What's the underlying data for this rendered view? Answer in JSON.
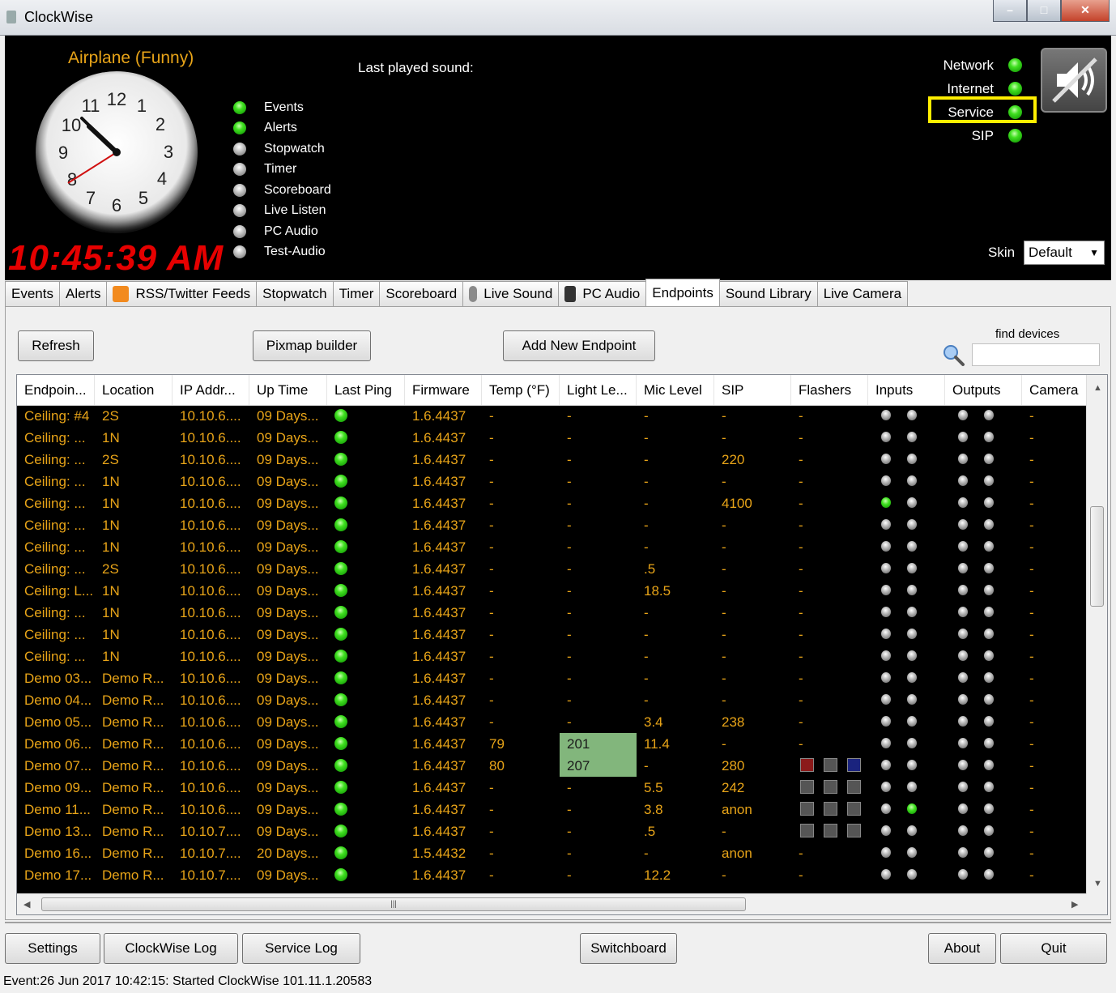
{
  "window": {
    "title": "ClockWise"
  },
  "header": {
    "track_name": "Airplane (Funny)",
    "digital_time": "10:45:39 AM",
    "last_played_label": "Last played sound:",
    "status_items": [
      {
        "label": "Events",
        "state": "green"
      },
      {
        "label": "Alerts",
        "state": "green"
      },
      {
        "label": "Stopwatch",
        "state": "grey"
      },
      {
        "label": "Timer",
        "state": "grey"
      },
      {
        "label": "Scoreboard",
        "state": "grey"
      },
      {
        "label": "Live Listen",
        "state": "grey"
      },
      {
        "label": "PC Audio",
        "state": "grey"
      },
      {
        "label": "Test-Audio",
        "state": "grey"
      }
    ],
    "network_status": [
      {
        "label": "Network",
        "state": "green"
      },
      {
        "label": "Internet",
        "state": "green"
      },
      {
        "label": "Service",
        "state": "green",
        "highlighted": true
      },
      {
        "label": "SIP",
        "state": "green"
      }
    ],
    "skin_label": "Skin",
    "skin_value": "Default"
  },
  "tabs": [
    {
      "label": "Events"
    },
    {
      "label": "Alerts"
    },
    {
      "label": "RSS/Twitter Feeds",
      "icon": "rss-icon"
    },
    {
      "label": "Stopwatch"
    },
    {
      "label": "Timer"
    },
    {
      "label": "Scoreboard"
    },
    {
      "label": "Live Sound",
      "icon": "microphone-icon"
    },
    {
      "label": "PC Audio",
      "icon": "speaker-icon"
    },
    {
      "label": "Endpoints",
      "active": true
    },
    {
      "label": "Sound Library"
    },
    {
      "label": "Live Camera"
    }
  ],
  "toolbar": {
    "refresh": "Refresh",
    "pixmap": "Pixmap builder",
    "add_endpoint": "Add New Endpoint",
    "find_label": "find devices",
    "find_value": ""
  },
  "grid": {
    "columns": [
      "Endpoin...",
      "Location",
      "IP Addr...",
      "Up Time",
      "Last Ping",
      "Firmware",
      "Temp (°F)",
      "Light Le...",
      "Mic Level",
      "SIP",
      "Flashers",
      "Inputs",
      "Outputs",
      "Camera"
    ],
    "rows": [
      {
        "endpoint": "Ceiling: #4",
        "location": "2S",
        "ip": "10.10.6....",
        "uptime": "09 Days...",
        "firmware": "1.6.4437",
        "temp": "-",
        "light": "-",
        "mic": "-",
        "sip": "-",
        "flashers": "-",
        "inputs": [
          "grey",
          "grey"
        ],
        "outputs": [
          "grey",
          "grey"
        ],
        "camera": "-"
      },
      {
        "endpoint": "Ceiling: ...",
        "location": "1N",
        "ip": "10.10.6....",
        "uptime": "09 Days...",
        "firmware": "1.6.4437",
        "temp": "-",
        "light": "-",
        "mic": "-",
        "sip": "-",
        "flashers": "-",
        "inputs": [
          "grey",
          "grey"
        ],
        "outputs": [
          "grey",
          "grey"
        ],
        "camera": "-"
      },
      {
        "endpoint": "Ceiling: ...",
        "location": "2S",
        "ip": "10.10.6....",
        "uptime": "09 Days...",
        "firmware": "1.6.4437",
        "temp": "-",
        "light": "-",
        "mic": "-",
        "sip": "220",
        "flashers": "-",
        "inputs": [
          "grey",
          "grey"
        ],
        "outputs": [
          "grey",
          "grey"
        ],
        "camera": "-"
      },
      {
        "endpoint": "Ceiling: ...",
        "location": "1N",
        "ip": "10.10.6....",
        "uptime": "09 Days...",
        "firmware": "1.6.4437",
        "temp": "-",
        "light": "-",
        "mic": "-",
        "sip": "-",
        "flashers": "-",
        "inputs": [
          "grey",
          "grey"
        ],
        "outputs": [
          "grey",
          "grey"
        ],
        "camera": "-"
      },
      {
        "endpoint": "Ceiling: ...",
        "location": "1N",
        "ip": "10.10.6....",
        "uptime": "09 Days...",
        "firmware": "1.6.4437",
        "temp": "-",
        "light": "-",
        "mic": "-",
        "sip": "4100",
        "flashers": "-",
        "inputs": [
          "green",
          "grey"
        ],
        "outputs": [
          "grey",
          "grey"
        ],
        "camera": "-"
      },
      {
        "endpoint": "Ceiling: ...",
        "location": "1N",
        "ip": "10.10.6....",
        "uptime": "09 Days...",
        "firmware": "1.6.4437",
        "temp": "-",
        "light": "-",
        "mic": "-",
        "sip": "-",
        "flashers": "-",
        "inputs": [
          "grey",
          "grey"
        ],
        "outputs": [
          "grey",
          "grey"
        ],
        "camera": "-"
      },
      {
        "endpoint": "Ceiling: ...",
        "location": "1N",
        "ip": "10.10.6....",
        "uptime": "09 Days...",
        "firmware": "1.6.4437",
        "temp": "-",
        "light": "-",
        "mic": "-",
        "sip": "-",
        "flashers": "-",
        "inputs": [
          "grey",
          "grey"
        ],
        "outputs": [
          "grey",
          "grey"
        ],
        "camera": "-"
      },
      {
        "endpoint": "Ceiling: ...",
        "location": "2S",
        "ip": "10.10.6....",
        "uptime": "09 Days...",
        "firmware": "1.6.4437",
        "temp": "-",
        "light": "-",
        "mic": ".5",
        "sip": "-",
        "flashers": "-",
        "inputs": [
          "grey",
          "grey"
        ],
        "outputs": [
          "grey",
          "grey"
        ],
        "camera": "-"
      },
      {
        "endpoint": "Ceiling: L...",
        "location": "1N",
        "ip": "10.10.6....",
        "uptime": "09 Days...",
        "firmware": "1.6.4437",
        "temp": "-",
        "light": "-",
        "mic": "18.5",
        "sip": "-",
        "flashers": "-",
        "inputs": [
          "grey",
          "grey"
        ],
        "outputs": [
          "grey",
          "grey"
        ],
        "camera": "-"
      },
      {
        "endpoint": "Ceiling: ...",
        "location": "1N",
        "ip": "10.10.6....",
        "uptime": "09 Days...",
        "firmware": "1.6.4437",
        "temp": "-",
        "light": "-",
        "mic": "-",
        "sip": "-",
        "flashers": "-",
        "inputs": [
          "grey",
          "grey"
        ],
        "outputs": [
          "grey",
          "grey"
        ],
        "camera": "-"
      },
      {
        "endpoint": "Ceiling: ...",
        "location": "1N",
        "ip": "10.10.6....",
        "uptime": "09 Days...",
        "firmware": "1.6.4437",
        "temp": "-",
        "light": "-",
        "mic": "-",
        "sip": "-",
        "flashers": "-",
        "inputs": [
          "grey",
          "grey"
        ],
        "outputs": [
          "grey",
          "grey"
        ],
        "camera": "-"
      },
      {
        "endpoint": "Ceiling: ...",
        "location": "1N",
        "ip": "10.10.6....",
        "uptime": "09 Days...",
        "firmware": "1.6.4437",
        "temp": "-",
        "light": "-",
        "mic": "-",
        "sip": "-",
        "flashers": "-",
        "inputs": [
          "grey",
          "grey"
        ],
        "outputs": [
          "grey",
          "grey"
        ],
        "camera": "-"
      },
      {
        "endpoint": "Demo 03...",
        "location": "Demo R...",
        "ip": "10.10.6....",
        "uptime": "09 Days...",
        "firmware": "1.6.4437",
        "temp": "-",
        "light": "-",
        "mic": "-",
        "sip": "-",
        "flashers": "-",
        "inputs": [
          "grey",
          "grey"
        ],
        "outputs": [
          "grey",
          "grey"
        ],
        "camera": "-"
      },
      {
        "endpoint": "Demo 04...",
        "location": "Demo R...",
        "ip": "10.10.6....",
        "uptime": "09 Days...",
        "firmware": "1.6.4437",
        "temp": "-",
        "light": "-",
        "mic": "-",
        "sip": "-",
        "flashers": "-",
        "inputs": [
          "grey",
          "grey"
        ],
        "outputs": [
          "grey",
          "grey"
        ],
        "camera": "-"
      },
      {
        "endpoint": "Demo 05...",
        "location": "Demo R...",
        "ip": "10.10.6....",
        "uptime": "09 Days...",
        "firmware": "1.6.4437",
        "temp": "-",
        "light": "-",
        "mic": "3.4",
        "sip": "238",
        "flashers": "-",
        "inputs": [
          "grey",
          "grey"
        ],
        "outputs": [
          "grey",
          "grey"
        ],
        "camera": "-"
      },
      {
        "endpoint": "Demo 06...",
        "location": "Demo R...",
        "ip": "10.10.6....",
        "uptime": "09 Days...",
        "firmware": "1.6.4437",
        "temp": "79",
        "light": "201",
        "light_hi": true,
        "mic": "11.4",
        "sip": "-",
        "flashers": "-",
        "inputs": [
          "grey",
          "grey"
        ],
        "outputs": [
          "grey",
          "grey"
        ],
        "camera": "-"
      },
      {
        "endpoint": "Demo 07...",
        "location": "Demo R...",
        "ip": "10.10.6....",
        "uptime": "09 Days...",
        "firmware": "1.6.4437",
        "temp": "80",
        "light": "207",
        "light_hi": true,
        "mic": "-",
        "sip": "280",
        "flashers": [
          "#8b1a1a",
          "#555555",
          "#1a237e"
        ],
        "inputs": [
          "grey",
          "grey"
        ],
        "outputs": [
          "grey",
          "grey"
        ],
        "camera": "-"
      },
      {
        "endpoint": "Demo 09...",
        "location": "Demo R...",
        "ip": "10.10.6....",
        "uptime": "09 Days...",
        "firmware": "1.6.4437",
        "temp": "-",
        "light": "-",
        "mic": "5.5",
        "sip": "242",
        "flashers": [
          "#555555",
          "#555555",
          "#555555"
        ],
        "inputs": [
          "grey",
          "grey"
        ],
        "outputs": [
          "grey",
          "grey"
        ],
        "camera": "-"
      },
      {
        "endpoint": "Demo 11...",
        "location": "Demo R...",
        "ip": "10.10.6....",
        "uptime": "09 Days...",
        "firmware": "1.6.4437",
        "temp": "-",
        "light": "-",
        "mic": "3.8",
        "sip": "anon",
        "flashers": [
          "#555555",
          "#555555",
          "#555555"
        ],
        "inputs": [
          "grey",
          "green"
        ],
        "outputs": [
          "grey",
          "grey"
        ],
        "camera": "-"
      },
      {
        "endpoint": "Demo 13...",
        "location": "Demo R...",
        "ip": "10.10.7....",
        "uptime": "09 Days...",
        "firmware": "1.6.4437",
        "temp": "-",
        "light": "-",
        "mic": ".5",
        "sip": "-",
        "flashers": [
          "#555555",
          "#555555",
          "#555555"
        ],
        "inputs": [
          "grey",
          "grey"
        ],
        "outputs": [
          "grey",
          "grey"
        ],
        "camera": "-"
      },
      {
        "endpoint": "Demo 16...",
        "location": "Demo R...",
        "ip": "10.10.7....",
        "uptime": "20 Days...",
        "firmware": "1.5.4432",
        "temp": "-",
        "light": "-",
        "mic": "-",
        "sip": "anon",
        "flashers": "-",
        "inputs": [
          "grey",
          "grey"
        ],
        "outputs": [
          "grey",
          "grey"
        ],
        "camera": "-"
      },
      {
        "endpoint": "Demo 17...",
        "location": "Demo R...",
        "ip": "10.10.7....",
        "uptime": "09 Days...",
        "firmware": "1.6.4437",
        "temp": "-",
        "light": "-",
        "mic": "12.2",
        "sip": "-",
        "flashers": "-",
        "inputs": [
          "grey",
          "grey"
        ],
        "outputs": [
          "grey",
          "grey"
        ],
        "camera": "-"
      }
    ]
  },
  "bottom": {
    "settings": "Settings",
    "clockwise_log": "ClockWise Log",
    "service_log": "Service Log",
    "switchboard": "Switchboard",
    "about": "About",
    "quit": "Quit"
  },
  "statusbar": "Event:26 Jun 2017 10:42:15:  Started ClockWise 101.11.1.20583"
}
